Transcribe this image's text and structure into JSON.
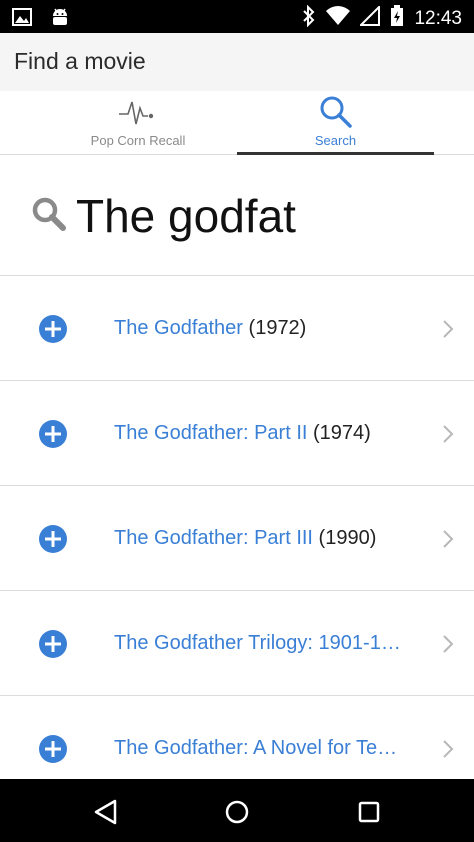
{
  "status_bar": {
    "time": "12:43",
    "left_icons": [
      "image-icon",
      "android-icon"
    ],
    "right_icons": [
      "bluetooth-icon",
      "wifi-icon",
      "signal-icon",
      "battery-icon"
    ]
  },
  "header": {
    "title": "Find a movie"
  },
  "tabs": [
    {
      "label": "Pop Corn Recall",
      "icon": "pulse-icon",
      "selected": false
    },
    {
      "label": "Search",
      "icon": "search-icon",
      "selected": true
    }
  ],
  "search": {
    "value": "The godfat"
  },
  "results": [
    {
      "title": "The Godfather",
      "year": "(1972)"
    },
    {
      "title": "The Godfather: Part II",
      "year": "(1974)"
    },
    {
      "title": "The Godfather: Part III",
      "year": "(1990)"
    },
    {
      "title": "The Godfather Trilogy: 1901-1…",
      "year": ""
    },
    {
      "title": "The Godfather: A Novel for Te…",
      "year": ""
    }
  ],
  "colors": {
    "accent": "#3a7fd6",
    "add_button": "#3a7fd6"
  },
  "nav_bar": [
    "back-icon",
    "home-icon",
    "recent-apps-icon"
  ]
}
